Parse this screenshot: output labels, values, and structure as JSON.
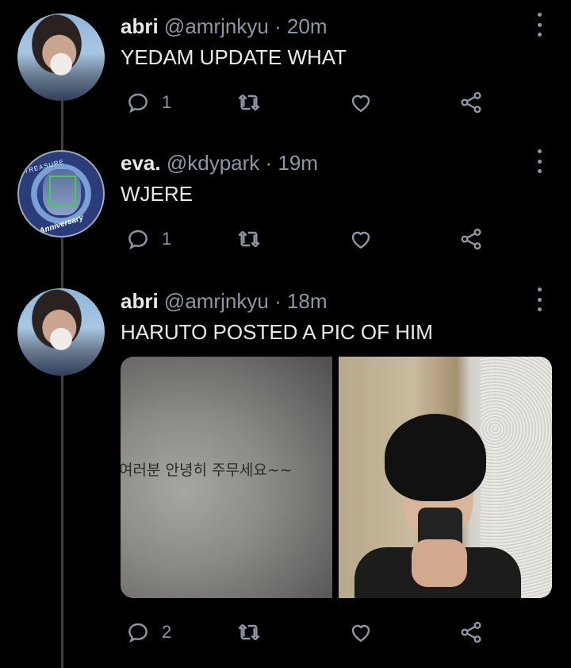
{
  "tweets": [
    {
      "name": "abri",
      "meta": "@amrjnkyu · 20m",
      "text": "YEDAM UPDATE WHAT",
      "replies": "1"
    },
    {
      "name": "eva.",
      "meta": "@kdypark · 19m",
      "text": "WJERE",
      "replies": "1",
      "avatar_text_top": "TREASURE",
      "avatar_text_bottom": "1st Anniversary"
    },
    {
      "name": "abri",
      "meta": "@amrjnkyu · 18m",
      "text": "HARUTO POSTED A PIC OF HIM",
      "replies": "2",
      "media_left_text": "여러분 안녕히 주무세요~~"
    }
  ],
  "icons": {
    "reply": "reply-icon",
    "retweet": "retweet-icon",
    "like": "heart-icon",
    "share": "share-icon",
    "more": "more-icon"
  },
  "colors": {
    "background": "#000000",
    "text": "#e7e9ea",
    "secondary": "#8b98a5",
    "thread_line": "#3e4144"
  }
}
